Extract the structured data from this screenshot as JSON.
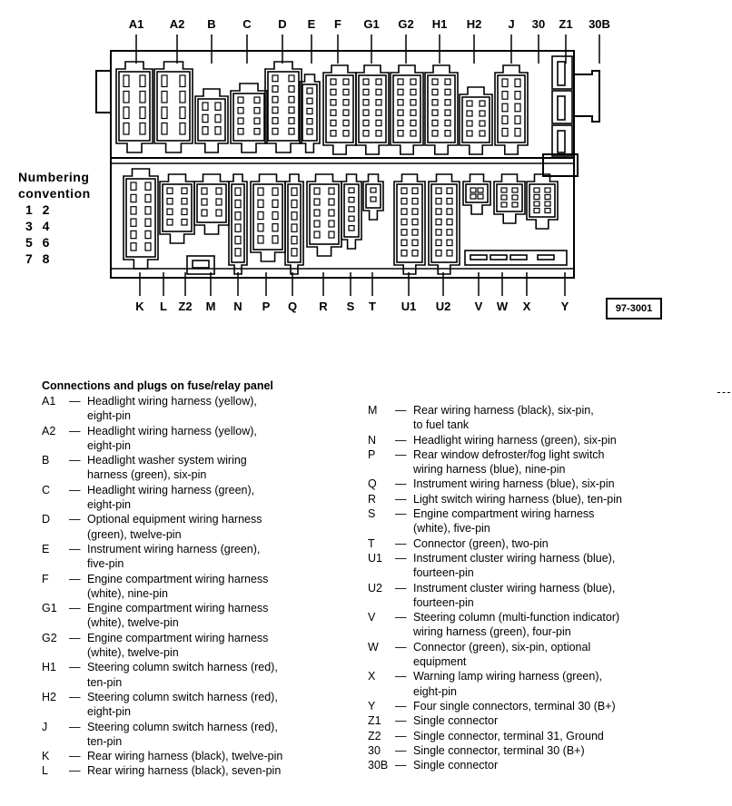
{
  "diagram": {
    "top_labels": [
      "A1",
      "A2",
      "B",
      "C",
      "D",
      "E",
      "F",
      "G1",
      "G2",
      "H1",
      "H2",
      "J",
      "30",
      "Z1",
      "30B"
    ],
    "bottom_labels": [
      "K",
      "L",
      "Z2",
      "M",
      "N",
      "P",
      "Q",
      "R",
      "S",
      "T",
      "U1",
      "U2",
      "V",
      "W",
      "X",
      "Y"
    ],
    "reference_code": "97-3001",
    "numbering": {
      "title_line1": "Numbering",
      "title_line2": "convention",
      "rows": [
        "1  2",
        "3  4",
        "5  6",
        "7  8"
      ]
    }
  },
  "legend": {
    "title": "Connections and plugs on fuse/relay panel",
    "left": [
      {
        "code": "A1",
        "text": "Headlight wiring harness (yellow),\neight-pin"
      },
      {
        "code": "A2",
        "text": "Headlight wiring harness (yellow),\neight-pin"
      },
      {
        "code": "B",
        "text": "Headlight washer system wiring\nharness (green), six-pin"
      },
      {
        "code": "C",
        "text": "Headlight wiring harness (green),\neight-pin"
      },
      {
        "code": "D",
        "text": "Optional equipment wiring harness\n(green), twelve-pin"
      },
      {
        "code": "E",
        "text": "Instrument wiring harness (green),\nfive-pin"
      },
      {
        "code": "F",
        "text": "Engine compartment wiring harness\n(white), nine-pin"
      },
      {
        "code": "G1",
        "text": "Engine compartment wiring harness\n(white), twelve-pin"
      },
      {
        "code": "G2",
        "text": "Engine compartment wiring harness\n(white), twelve-pin"
      },
      {
        "code": "H1",
        "text": "Steering column switch harness (red),\nten-pin"
      },
      {
        "code": "H2",
        "text": "Steering column switch harness (red),\neight-pin"
      },
      {
        "code": "J",
        "text": "Steering column switch harness (red),\nten-pin"
      },
      {
        "code": "K",
        "text": "Rear wiring harness (black), twelve-pin"
      },
      {
        "code": "L",
        "text": "Rear wiring harness (black), seven-pin"
      }
    ],
    "right": [
      {
        "code": "M",
        "text": "Rear wiring harness (black), six-pin,\nto fuel tank"
      },
      {
        "code": "N",
        "text": "Headlight wiring harness (green), six-pin"
      },
      {
        "code": "P",
        "text": "Rear window defroster/fog light switch\nwiring harness (blue), nine-pin"
      },
      {
        "code": "Q",
        "text": "Instrument wiring harness (blue), six-pin"
      },
      {
        "code": "R",
        "text": "Light switch wiring harness (blue), ten-pin"
      },
      {
        "code": "S",
        "text": "Engine compartment wiring harness\n(white), five-pin"
      },
      {
        "code": "T",
        "text": "Connector (green), two-pin"
      },
      {
        "code": "U1",
        "text": "Instrument cluster wiring harness (blue),\nfourteen-pin"
      },
      {
        "code": "U2",
        "text": "Instrument cluster wiring harness (blue),\nfourteen-pin"
      },
      {
        "code": "V",
        "text": "Steering column (multi-function indicator)\nwiring harness (green), four-pin"
      },
      {
        "code": "W",
        "text": "Connector (green), six-pin, optional\nequipment"
      },
      {
        "code": "X",
        "text": "Warning lamp wiring harness (green),\neight-pin"
      },
      {
        "code": "Y",
        "text": "Four single connectors, terminal 30 (B+)"
      },
      {
        "code": "Z1",
        "text": "Single connector"
      },
      {
        "code": "Z2",
        "text": "Single connector, terminal 31, Ground"
      },
      {
        "code": "30",
        "text": "Single connector, terminal 30 (B+)"
      },
      {
        "code": "30B",
        "text": "Single connector"
      }
    ],
    "dash": "—"
  }
}
